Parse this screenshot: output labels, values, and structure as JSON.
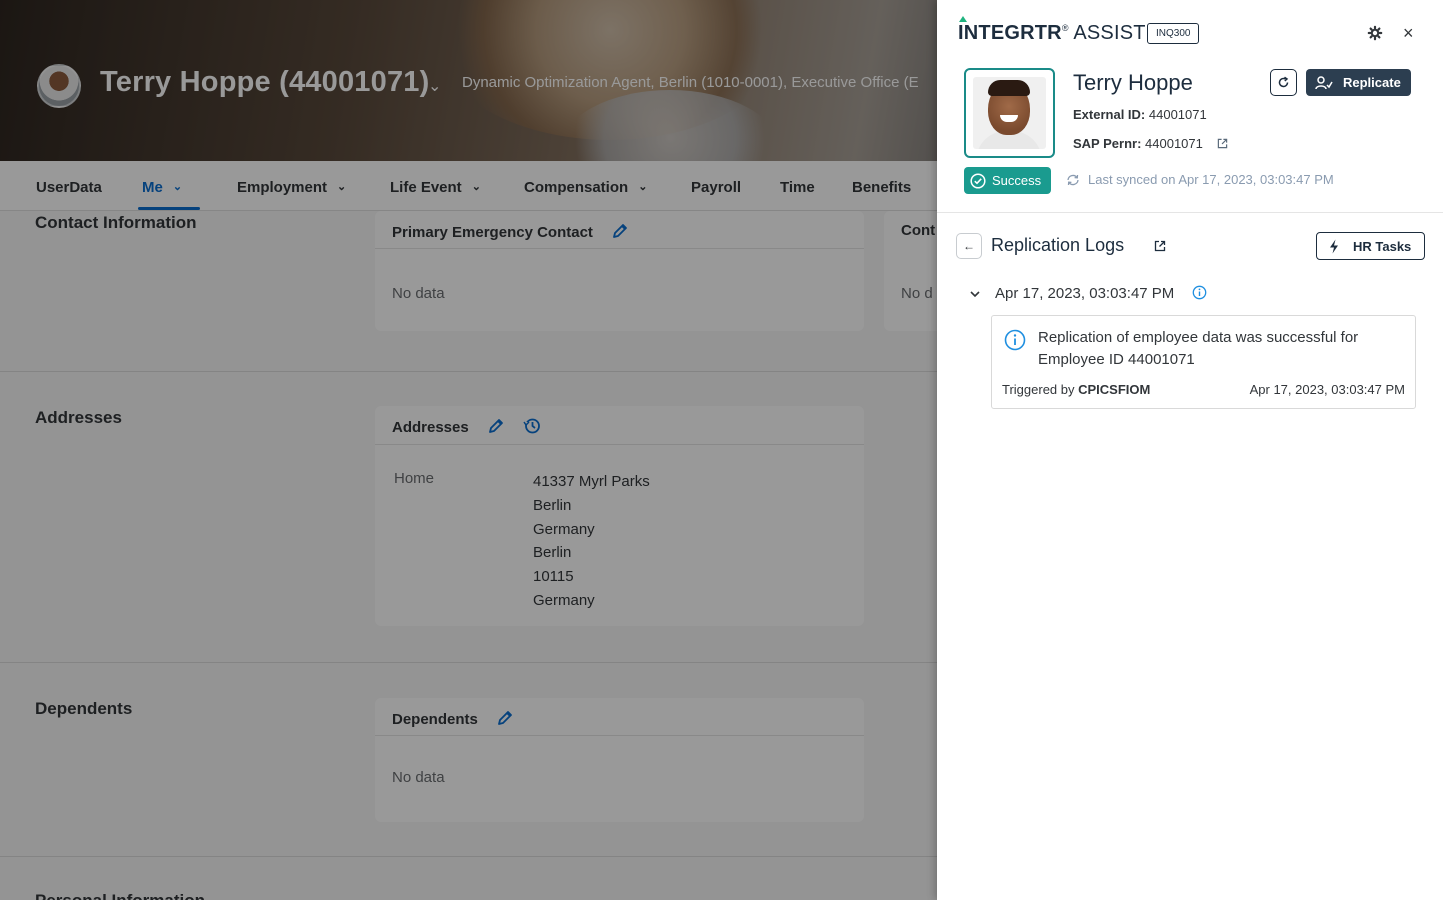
{
  "app": {
    "profile_name": "Terry Hoppe (44001071)",
    "profile_subtitle": "Dynamic Optimization Agent, Berlin (1010-0001), Executive Office (E"
  },
  "nav": {
    "items": [
      {
        "label": "UserData"
      },
      {
        "label": "Me"
      },
      {
        "label": "Employment"
      },
      {
        "label": "Life Event"
      },
      {
        "label": "Compensation"
      },
      {
        "label": "Payroll"
      },
      {
        "label": "Time"
      },
      {
        "label": "Benefits"
      }
    ]
  },
  "sections": {
    "contact": {
      "title": "Contact Information",
      "card_title": "Primary Emergency Contact",
      "card2_title": "Cont",
      "no_data": "No data",
      "no_data2": "No d"
    },
    "addresses": {
      "title": "Addresses",
      "card_title": "Addresses",
      "label": "Home",
      "lines": [
        "41337 Myrl Parks",
        "Berlin",
        "Germany",
        "Berlin",
        "10115",
        "Germany"
      ]
    },
    "dependents": {
      "title": "Dependents",
      "card_title": "Dependents",
      "no_data": "No data"
    },
    "partial_next": "Personal Information"
  },
  "panel": {
    "logo_brand": "INTEGRTR",
    "logo_reg": "®",
    "logo_suffix": " ASSIST",
    "tag": "INQ300",
    "person": {
      "name": "Terry Hoppe",
      "external_id_label": "External ID:",
      "external_id": "44001071",
      "sap_pernr_label": "SAP Pernr:",
      "sap_pernr": "44001071"
    },
    "replicate_label": "Replicate",
    "status": "Success",
    "last_synced": "Last synced on Apr 17, 2023, 03:03:47 PM",
    "logs": {
      "title": "Replication Logs",
      "hr_tasks_label": "HR Tasks",
      "entries": [
        {
          "date": "Apr 17, 2023, 03:03:47 PM",
          "message": "Replication of employee data was successful for Employee ID 44001071",
          "triggered_by_label": "Triggered by",
          "triggered_by": "CPICSFIOM",
          "timestamp": "Apr 17, 2023, 03:03:47 PM"
        }
      ]
    }
  },
  "colors": {
    "accent": "#0a6ed1",
    "status_success": "#1a9b8f",
    "primary_button": "#2c3e50"
  }
}
